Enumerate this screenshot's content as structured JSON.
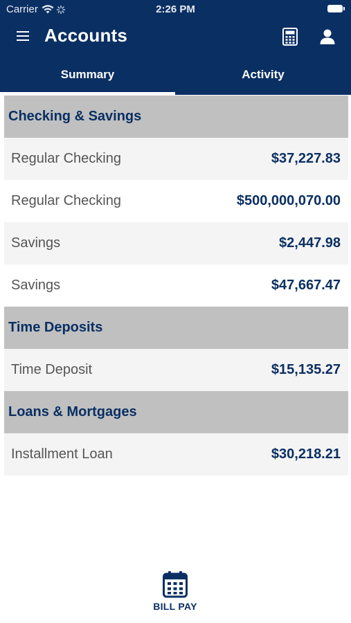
{
  "status_bar": {
    "carrier": "Carrier",
    "time": "2:26 PM"
  },
  "header": {
    "title": "Accounts",
    "menu_icon": "hamburger-menu-icon",
    "calculator_icon": "calculator-icon",
    "profile_icon": "user-icon"
  },
  "tabs": [
    {
      "label": "Summary",
      "selected": true
    },
    {
      "label": "Activity",
      "selected": false
    }
  ],
  "sections": [
    {
      "title": "Checking & Savings",
      "accounts": [
        {
          "name": "Regular Checking",
          "amount": "$37,227.83"
        },
        {
          "name": "Regular Checking",
          "amount": "$500,000,070.00"
        },
        {
          "name": "Savings",
          "amount": "$2,447.98"
        },
        {
          "name": "Savings",
          "amount": "$47,667.47"
        }
      ]
    },
    {
      "title": "Time Deposits",
      "accounts": [
        {
          "name": "Time Deposit",
          "amount": "$15,135.27"
        }
      ]
    },
    {
      "title": "Loans & Mortgages",
      "accounts": [
        {
          "name": "Installment Loan",
          "amount": "$30,218.21"
        }
      ]
    }
  ],
  "bottom_bar": {
    "label": "BILL PAY",
    "icon": "calendar-icon"
  },
  "colors": {
    "brand_navy": "#0a2f63",
    "section_gray": "#c0c0c0",
    "row_alt": "#f4f4f4"
  }
}
